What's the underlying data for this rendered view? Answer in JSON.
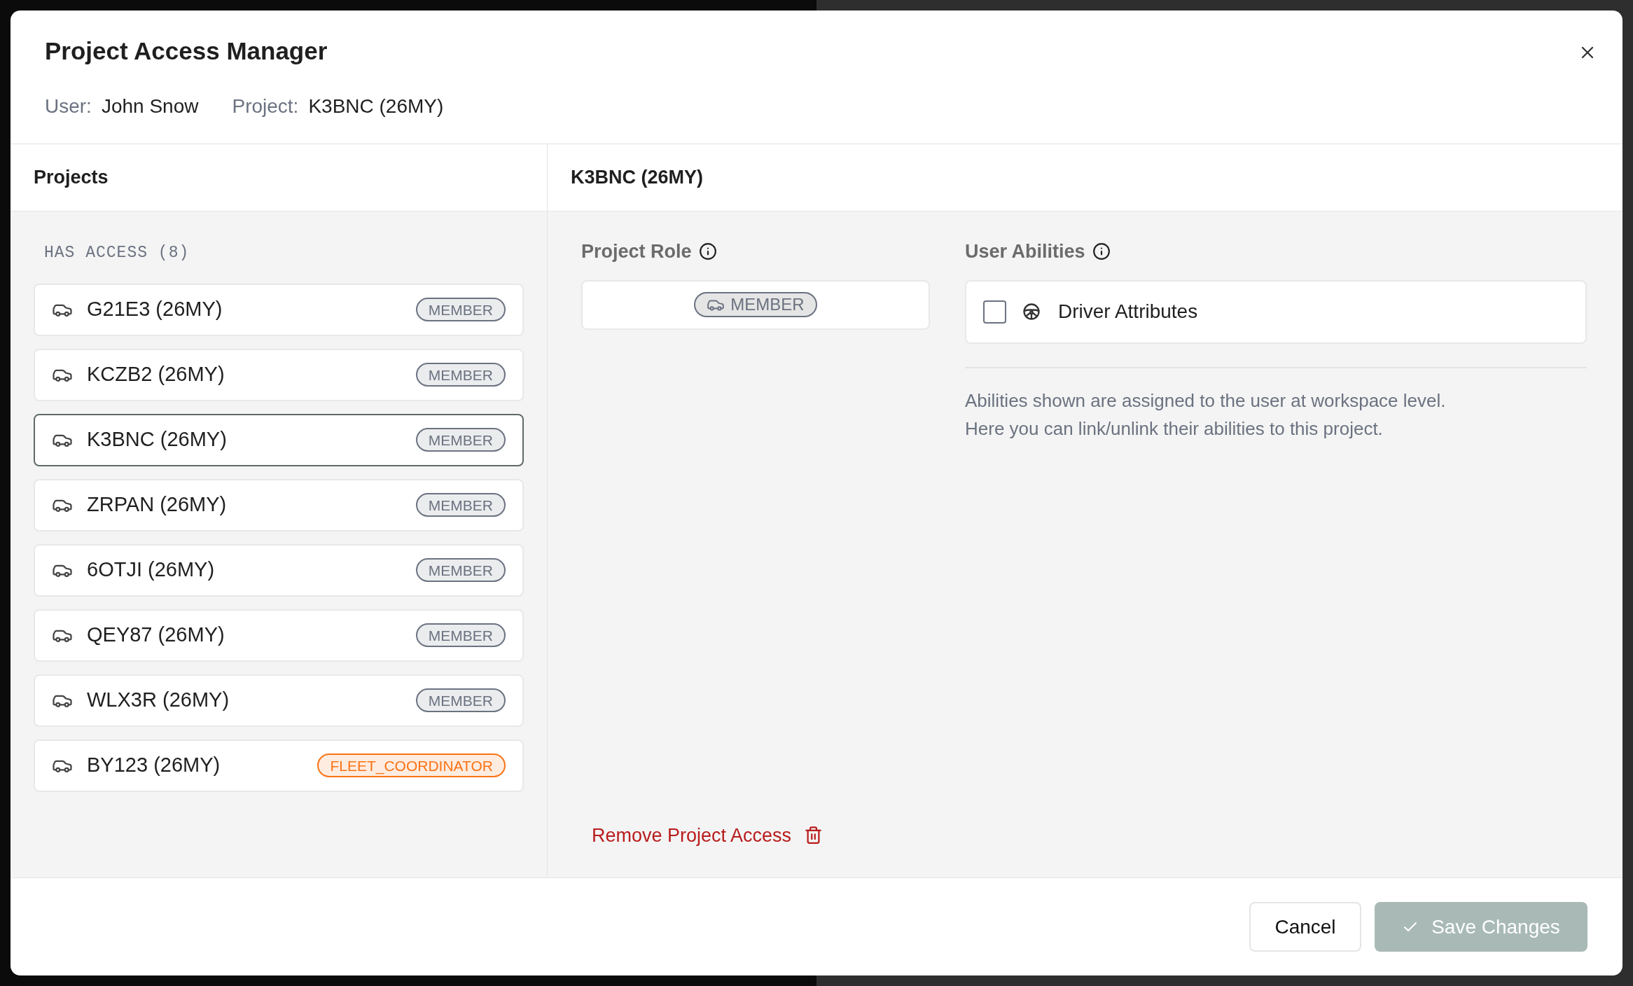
{
  "dialog": {
    "title": "Project Access Manager",
    "user_label": "User:",
    "user_value": "John Snow",
    "project_label": "Project:",
    "project_value": "K3BNC (26MY)"
  },
  "projects_panel": {
    "heading": "Projects",
    "section_label": "HAS ACCESS (8)",
    "items": [
      {
        "name": "G21E3 (26MY)",
        "role": "MEMBER",
        "color": "#6b7280",
        "selected": false
      },
      {
        "name": "KCZB2 (26MY)",
        "role": "MEMBER",
        "color": "#6b7280",
        "selected": false
      },
      {
        "name": "K3BNC (26MY)",
        "role": "MEMBER",
        "color": "#6b7280",
        "selected": true
      },
      {
        "name": "ZRPAN (26MY)",
        "role": "MEMBER",
        "color": "#6b7280",
        "selected": false
      },
      {
        "name": "6OTJI (26MY)",
        "role": "MEMBER",
        "color": "#6b7280",
        "selected": false
      },
      {
        "name": "QEY87 (26MY)",
        "role": "MEMBER",
        "color": "#6b7280",
        "selected": false
      },
      {
        "name": "WLX3R (26MY)",
        "role": "MEMBER",
        "color": "#6b7280",
        "selected": false
      },
      {
        "name": "BY123 (26MY)",
        "role": "FLEET_COORDINATOR",
        "color": "#f97316",
        "selected": false
      }
    ]
  },
  "detail_panel": {
    "heading": "K3BNC (26MY)",
    "role_label": "Project Role",
    "role": "MEMBER",
    "abilities_label": "User Abilities",
    "abilities": [
      {
        "name": "Driver Attributes",
        "checked": false
      }
    ],
    "description_lines": [
      "Abilities shown are assigned to the user at workspace level.",
      "Here you can link/unlink their abilities to this project."
    ],
    "remove_link": "Remove Project Access"
  },
  "footer": {
    "cancel": "Cancel",
    "save": "Save Changes",
    "save_disabled": true
  }
}
